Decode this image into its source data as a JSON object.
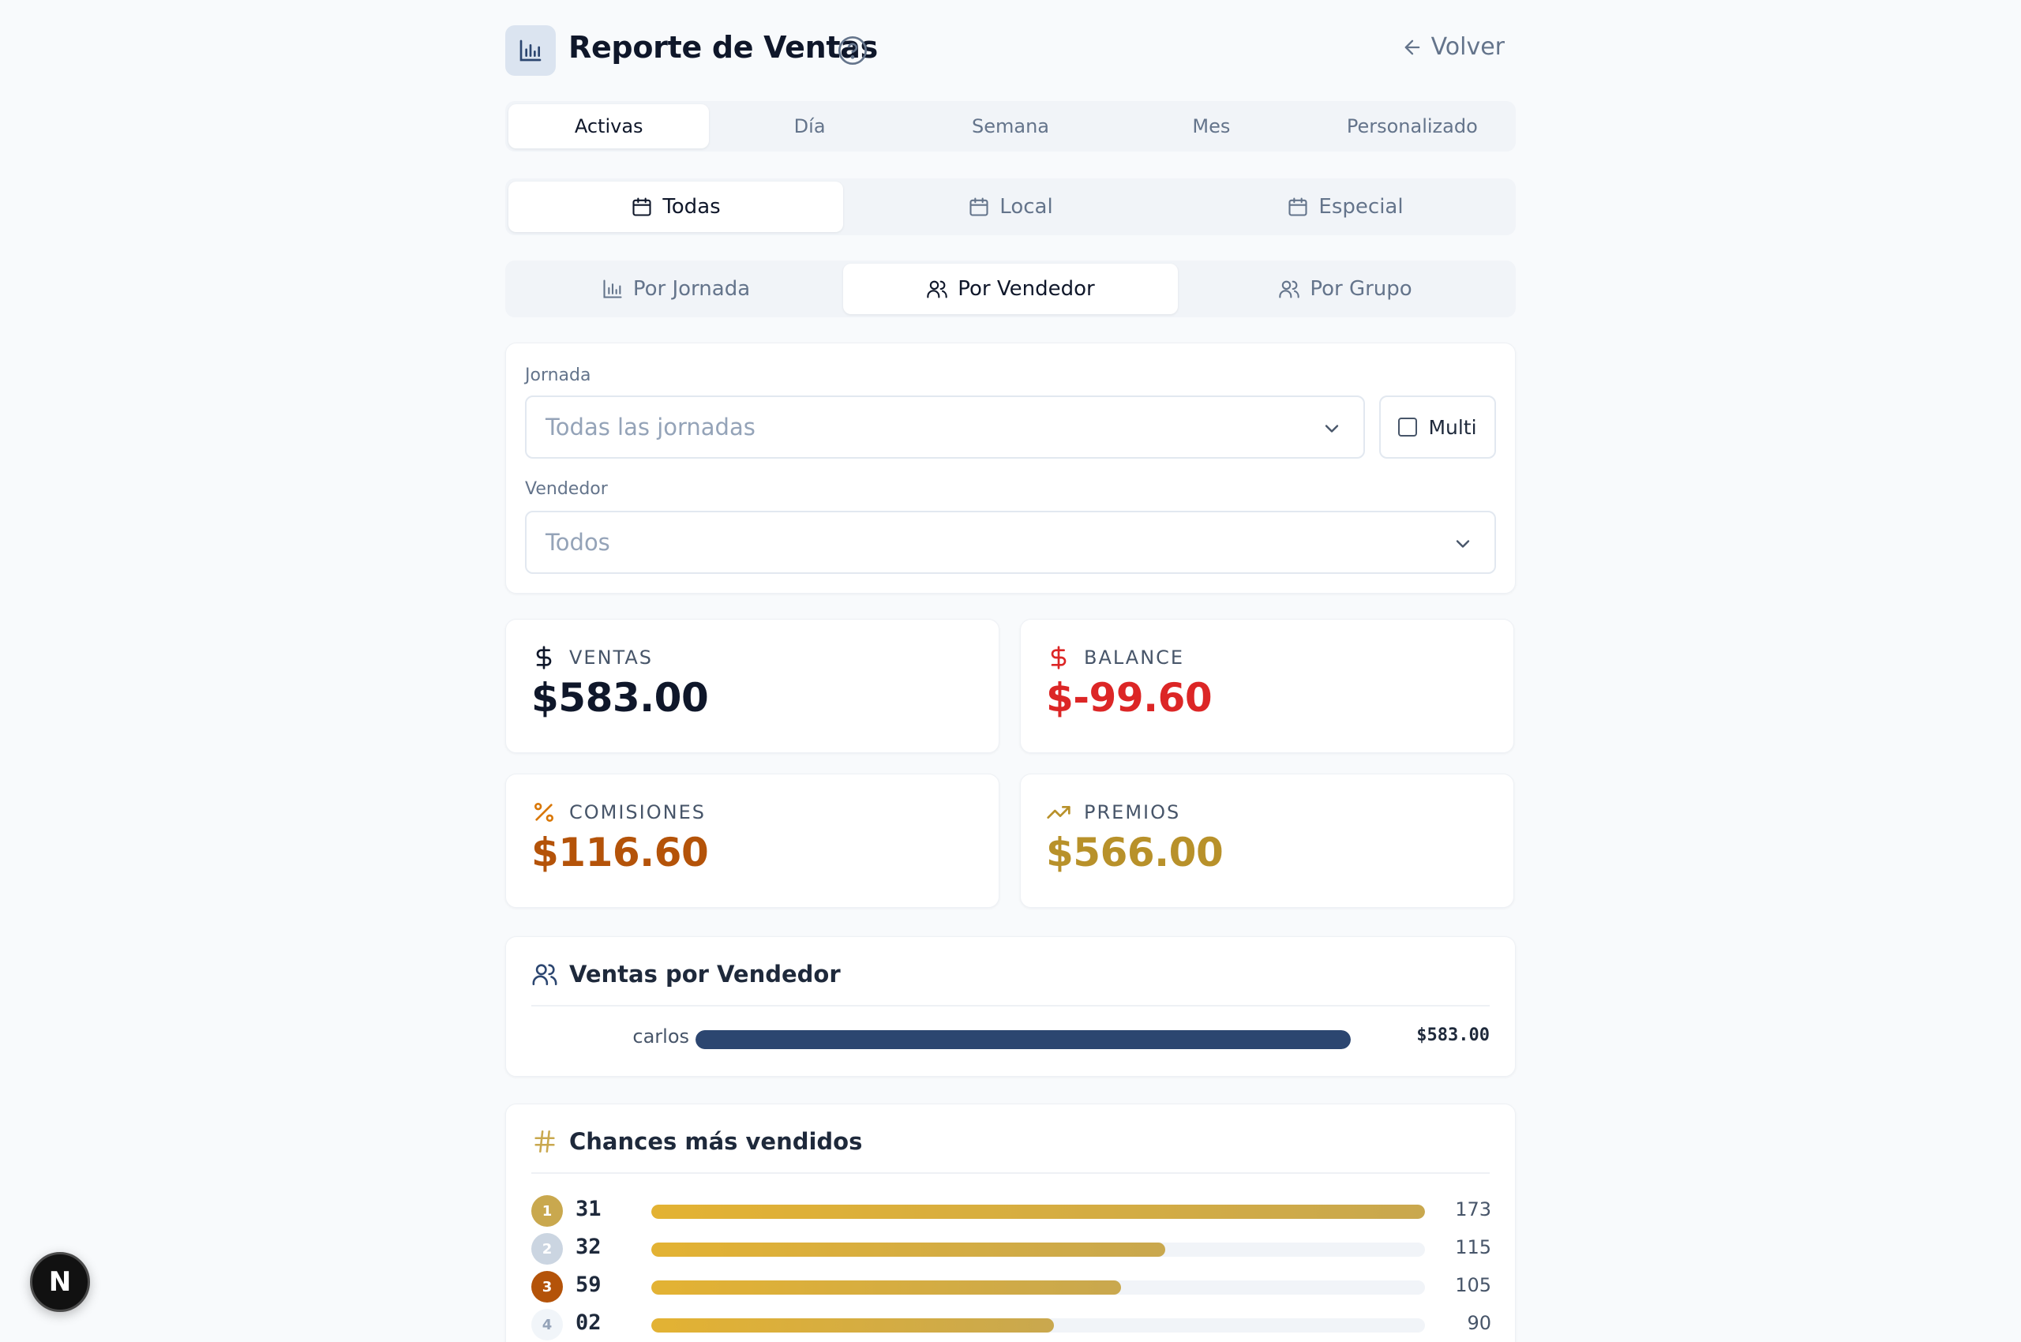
{
  "header": {
    "title": "Reporte de Ventas",
    "back_label": "Volver"
  },
  "period_tabs": {
    "active": 0,
    "items": [
      "Activas",
      "Día",
      "Semana",
      "Mes",
      "Personalizado"
    ]
  },
  "type_tabs": {
    "active": 0,
    "items": [
      "Todas",
      "Local",
      "Especial"
    ]
  },
  "view_tabs": {
    "active": 1,
    "items": [
      "Por Jornada",
      "Por Vendedor",
      "Por Grupo"
    ]
  },
  "filters": {
    "jornada_label": "Jornada",
    "jornada_value": "Todas las jornadas",
    "multi_label": "Multi",
    "multi_checked": false,
    "vendedor_label": "Vendedor",
    "vendedor_value": "Todos"
  },
  "stats": {
    "ventas": {
      "label": "VENTAS",
      "value": "$583.00",
      "color": "#0f172a"
    },
    "balance": {
      "label": "BALANCE",
      "value": "$-99.60",
      "color": "#dc2626"
    },
    "comisiones": {
      "label": "COMISIONES",
      "value": "$116.60",
      "color": "#b45309"
    },
    "premios": {
      "label": "PREMIOS",
      "value": "$566.00",
      "color": "#b8912a"
    }
  },
  "sales_by_seller": {
    "title": "Ventas por Vendedor",
    "rows": [
      {
        "name": "carlos",
        "amount": "$583.00",
        "fraction": 1.0
      }
    ]
  },
  "top_chances": {
    "title": "Chances más vendidos",
    "max": 173,
    "rows": [
      {
        "rank": "1",
        "number": "31",
        "count": 173,
        "badge_color": "#c9a84e"
      },
      {
        "rank": "2",
        "number": "32",
        "count": 115,
        "badge_color": "#cbd5e1"
      },
      {
        "rank": "3",
        "number": "59",
        "count": 105,
        "badge_color": "#b45309"
      },
      {
        "rank": "4",
        "number": "02",
        "count": 90,
        "badge_color": "#f1f5f9"
      }
    ]
  },
  "fab": {
    "label": "N"
  },
  "colors": {
    "accent": "#2c4670",
    "gold": "#c9a84e",
    "danger": "#dc2626"
  }
}
